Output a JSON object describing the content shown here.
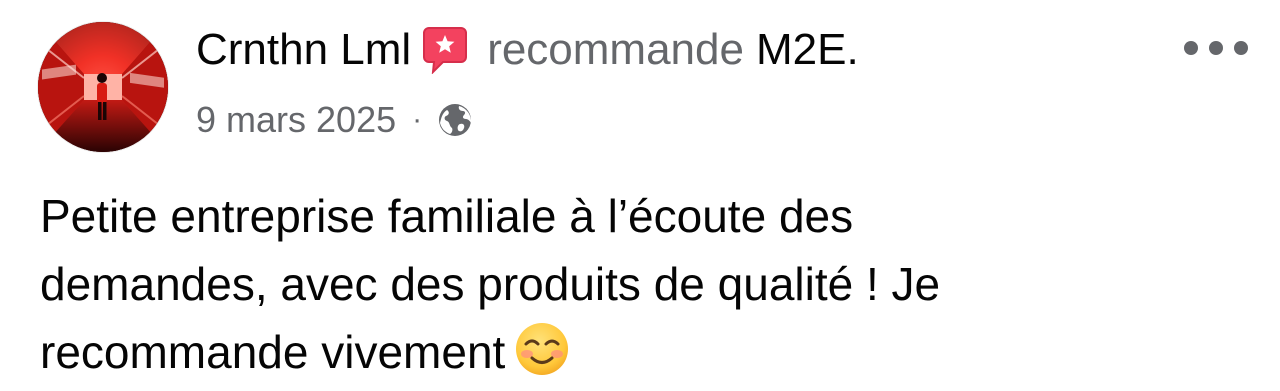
{
  "author": {
    "name": "Crnthn Lml",
    "avatar_icon": "profile-photo-red-corridor"
  },
  "recommendation": {
    "icon": "recommend-badge-icon",
    "icon_color": "#f3425f",
    "action_text": "recommande",
    "page_name": "M2E",
    "period": "."
  },
  "meta": {
    "date": "9 mars 2025",
    "separator": "·",
    "audience_icon": "globe-icon"
  },
  "more_button": {
    "icon": "more-options-icon"
  },
  "post": {
    "lines": [
      "Petite entreprise familiale à l’écoute des",
      "demandes, avec des produits de qualité ! Je",
      "recommande vivement"
    ],
    "emoji": "smiling-face-icon"
  },
  "colors": {
    "primary_text": "#050505",
    "secondary_text": "#65676b",
    "recommend_badge": "#f3425f"
  }
}
